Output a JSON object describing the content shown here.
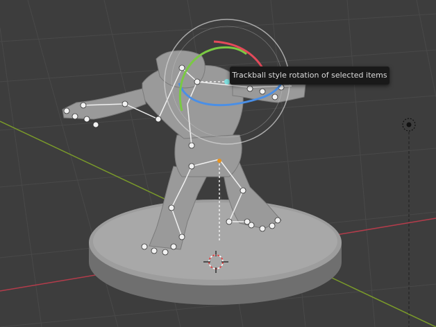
{
  "tooltip": {
    "text": "Trackball style rotation of selected items"
  },
  "gizmo": {
    "trackball_colors": {
      "x_axis": "#e44a5a",
      "y_axis": "#7ac943",
      "z_axis": "#4a8fe6",
      "outer_ring": "#d8d8d8"
    }
  },
  "colors": {
    "viewport_background": "#3d3d3d",
    "grid_line": "#494949",
    "x_axis_line": "#b43c4b",
    "y_axis_line": "#7a9a2a",
    "model": "#9a9a9a",
    "bones": "#e8e8e8",
    "active_bone_origin": "#e8931e"
  },
  "icons": {
    "light": "light-icon",
    "cursor": "3d-cursor-icon"
  }
}
